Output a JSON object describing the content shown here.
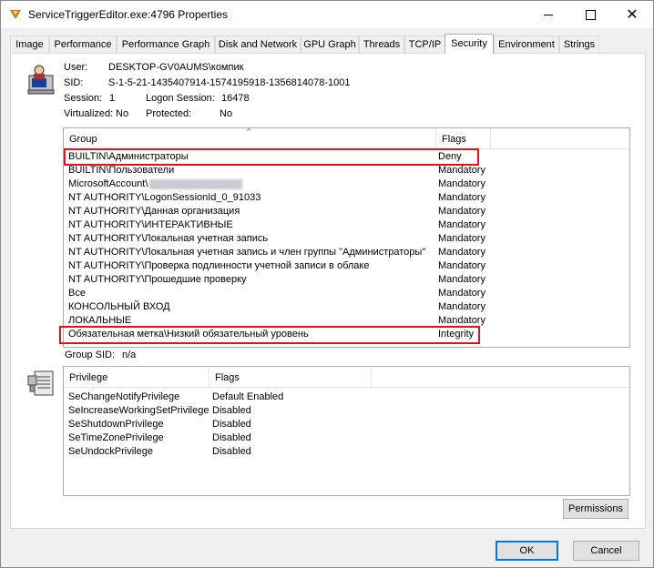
{
  "window": {
    "title": "ServiceTriggerEditor.exe:4796 Properties",
    "close_glyph": "✕",
    "icons": {
      "app": "process-explorer-icon",
      "minimize": "minimize-icon",
      "maximize": "maximize-icon",
      "close": "close-icon"
    }
  },
  "tabs": [
    "Image",
    "Performance",
    "Performance Graph",
    "Disk and Network",
    "GPU Graph",
    "Threads",
    "TCP/IP",
    "Security",
    "Environment",
    "Strings"
  ],
  "active_tab": "Security",
  "info": {
    "user_label": "User:",
    "user_value": "DESKTOP-GV0AUMS\\компик",
    "sid_label": "SID:",
    "sid_value": "S-1-5-21-1435407914-1574195918-1356814078-1001",
    "session_label": "Session:",
    "session_value": "1",
    "logon_label": "Logon Session:",
    "logon_value": "16478",
    "virtualized_label": "Virtualized:",
    "virtualized_value": "No",
    "protected_label": "Protected:",
    "protected_value": "No"
  },
  "groups": {
    "columns": {
      "group": "Group",
      "flags": "Flags"
    },
    "sort_glyph": "^",
    "rows": [
      {
        "group": "BUILTIN\\Администраторы",
        "flags": "Deny"
      },
      {
        "group": "BUILTIN\\Пользователи",
        "flags": "Mandatory"
      },
      {
        "group": "MicrosoftAccount\\",
        "flags": "Mandatory"
      },
      {
        "group": "NT AUTHORITY\\LogonSessionId_0_91033",
        "flags": "Mandatory"
      },
      {
        "group": "NT AUTHORITY\\Данная организация",
        "flags": "Mandatory"
      },
      {
        "group": "NT AUTHORITY\\ИНТЕРАКТИВНЫЕ",
        "flags": "Mandatory"
      },
      {
        "group": "NT AUTHORITY\\Локальная учетная запись",
        "flags": "Mandatory"
      },
      {
        "group": "NT AUTHORITY\\Локальная учетная запись и член группы \"Администраторы\"",
        "flags": "Mandatory"
      },
      {
        "group": "NT AUTHORITY\\Проверка подлинности учетной записи в облаке",
        "flags": "Mandatory"
      },
      {
        "group": "NT AUTHORITY\\Прошедшие проверку",
        "flags": "Mandatory"
      },
      {
        "group": "Все",
        "flags": "Mandatory"
      },
      {
        "group": "КОНСОЛЬНЫЙ ВХОД",
        "flags": "Mandatory"
      },
      {
        "group": "ЛОКАЛЬНЫЕ",
        "flags": "Mandatory"
      },
      {
        "group": "Обязательная метка\\Низкий обязательный уровень",
        "flags": "Integrity"
      }
    ],
    "group_sid_label": "Group SID:",
    "group_sid_value": "n/a"
  },
  "privileges": {
    "columns": {
      "privilege": "Privilege",
      "flags": "Flags"
    },
    "rows": [
      {
        "privilege": "SeChangeNotifyPrivilege",
        "flags": "Default Enabled"
      },
      {
        "privilege": "SeIncreaseWorkingSetPrivilege",
        "flags": "Disabled"
      },
      {
        "privilege": "SeShutdownPrivilege",
        "flags": "Disabled"
      },
      {
        "privilege": "SeTimeZonePrivilege",
        "flags": "Disabled"
      },
      {
        "privilege": "SeUndockPrivilege",
        "flags": "Disabled"
      }
    ]
  },
  "buttons": {
    "permissions": "Permissions",
    "ok": "OK",
    "cancel": "Cancel"
  },
  "colors": {
    "highlight": "#e0141e",
    "default_button_border": "#0078d7"
  }
}
